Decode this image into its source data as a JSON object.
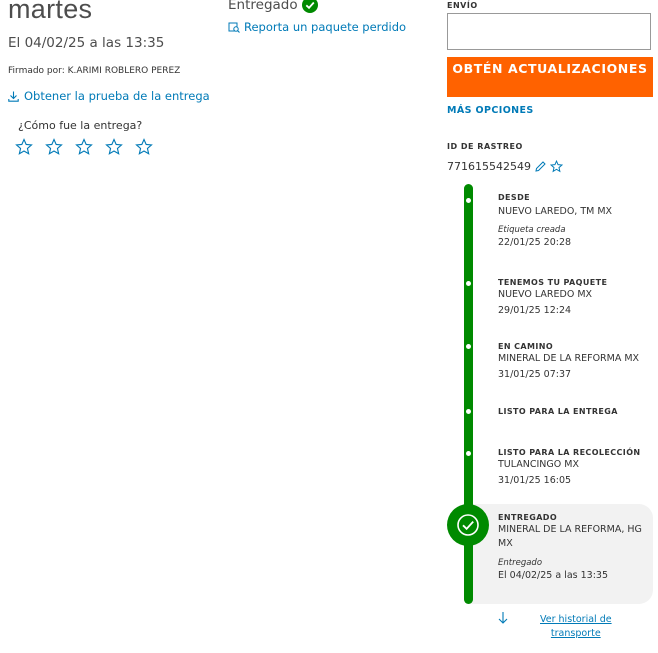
{
  "left": {
    "day": "martes",
    "datetime": "El 04/02/25 a las 13:35",
    "signed_by": "Firmado por: K.ARIMI ROBLERO PEREZ",
    "proof_link": "Obtener la prueba de la entrega",
    "rating_question": "¿Cómo fue la entrega?",
    "stars": 5
  },
  "center": {
    "status": "Entregado",
    "lost_package_link": "Reporta un paquete perdido"
  },
  "right": {
    "send_label": "ENVÍO",
    "send_value": "",
    "updates_button": "OBTÉN ACTUALIZACIONES",
    "more_options": "MÁS OPCIONES",
    "tracking_label": "ID DE RASTREO",
    "tracking_number": "771615542549",
    "events": [
      {
        "title": "DESDE",
        "location": "NUEVO LAREDO, TM MX",
        "note": "Etiqueta creada",
        "datetime": "22/01/25 20:28"
      },
      {
        "title": "TENEMOS TU PAQUETE",
        "location": "NUEVO LAREDO MX",
        "datetime": "29/01/25 12:24"
      },
      {
        "title": "EN CAMINO",
        "location": "MINERAL DE LA REFORMA MX",
        "datetime": "31/01/25 07:37"
      },
      {
        "title": "LISTO PARA LA ENTREGA"
      },
      {
        "title": "LISTO PARA LA RECOLECCIÓN",
        "location": "TULANCINGO MX",
        "datetime": "31/01/25 16:05"
      },
      {
        "title": "ENTREGADO",
        "location_1": "MINERAL DE LA REFORMA, HG",
        "location_2": "MX",
        "note": "Entregado",
        "datetime": "El 04/02/25 a las 13:35"
      }
    ],
    "history_line1": "Ver historial de",
    "history_line2": "transporte",
    "colors": {
      "accent": "#ff6200",
      "link": "#007ab7",
      "timeline": "#008a00"
    }
  }
}
